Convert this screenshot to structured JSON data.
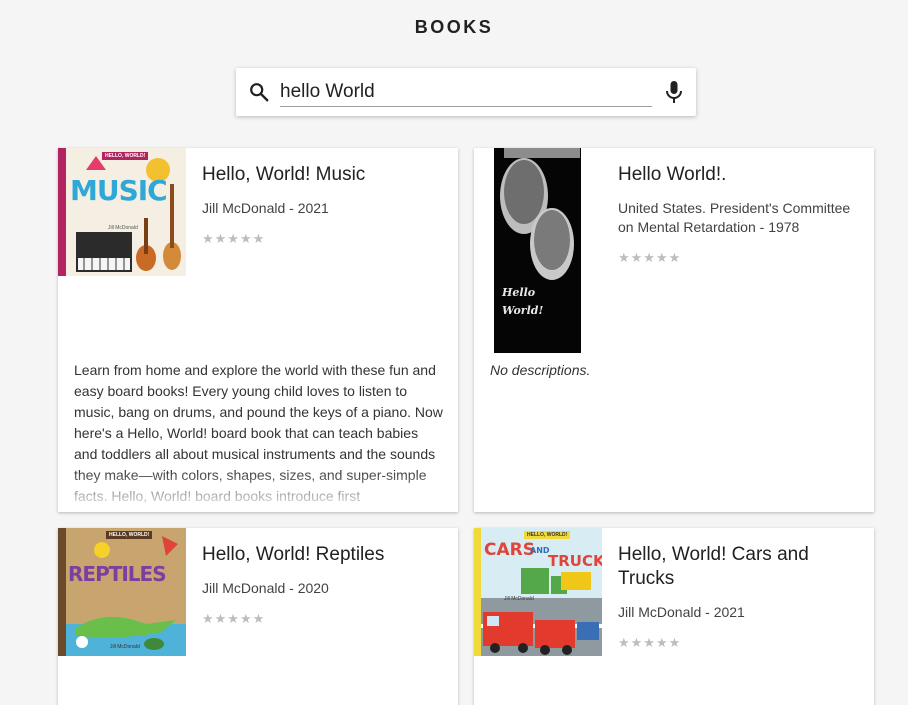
{
  "header": {
    "title": "BOOKS"
  },
  "search": {
    "value": "hello World",
    "icon": "search-icon",
    "mic_icon": "mic-icon"
  },
  "results": [
    {
      "title": "Hello, World! Music",
      "meta": "Jill McDonald - 2021",
      "rating_stars": "★★★★★",
      "rating": 0,
      "cover_text": "MUSIC",
      "cover_badge": "HELLO, WORLD!",
      "cover_author": "Jill McDonald",
      "description": "Learn from home and explore the world with these fun and easy board books! Every young child loves to listen to music, bang on drums, and pound the keys of a piano. Now here's a Hello, World! board book that can teach babies and toddlers all about musical instruments and the sounds they make—with colors, shapes, sizes, and super-simple facts. Hello, World! board books introduce first"
    },
    {
      "title": "Hello World!.",
      "meta": "United States. President's Committee on Mental Retardation - 1978",
      "rating_stars": "★★★★★",
      "rating": 0,
      "cover_text": "Hello World!",
      "description": "No descriptions."
    },
    {
      "title": "Hello, World! Reptiles",
      "meta": "Jill McDonald - 2020",
      "rating_stars": "★★★★★",
      "rating": 0,
      "cover_text": "REPTILES",
      "cover_badge": "HELLO, WORLD!",
      "cover_author": "Jill McDonald"
    },
    {
      "title": "Hello, World! Cars and Trucks",
      "meta": "Jill McDonald - 2021",
      "rating_stars": "★★★★★",
      "rating": 0,
      "cover_text_1": "CARS",
      "cover_text_2": "AND",
      "cover_text_3": "TRUCKS",
      "cover_badge": "HELLO, WORLD!",
      "cover_author": "Jill McDonald"
    }
  ]
}
